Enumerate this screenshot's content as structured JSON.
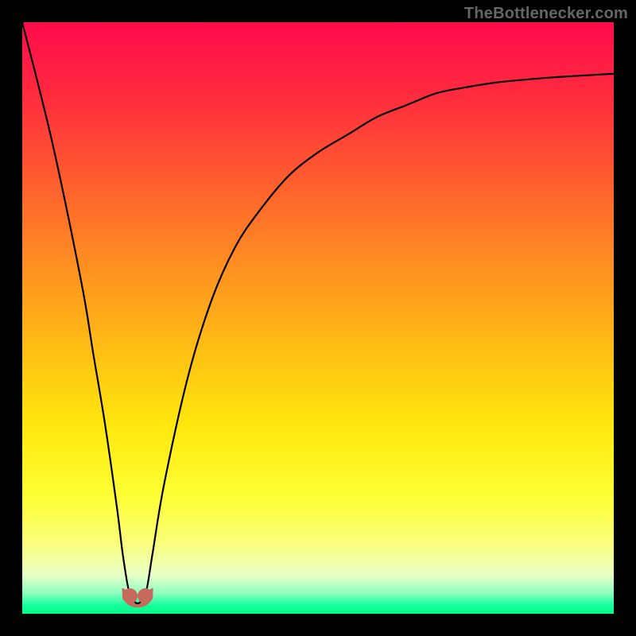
{
  "watermark": "TheBottlenecker.com",
  "gradient": {
    "stops": [
      {
        "offset": 0.0,
        "color": "#ff0b4b"
      },
      {
        "offset": 0.12,
        "color": "#ff2a3e"
      },
      {
        "offset": 0.25,
        "color": "#ff5730"
      },
      {
        "offset": 0.4,
        "color": "#ff8b22"
      },
      {
        "offset": 0.55,
        "color": "#ffbd14"
      },
      {
        "offset": 0.68,
        "color": "#ffe70d"
      },
      {
        "offset": 0.8,
        "color": "#feff33"
      },
      {
        "offset": 0.88,
        "color": "#faff7a"
      },
      {
        "offset": 0.935,
        "color": "#e8ffc8"
      },
      {
        "offset": 0.965,
        "color": "#8effc0"
      },
      {
        "offset": 0.985,
        "color": "#17ff9c"
      },
      {
        "offset": 1.0,
        "color": "#00ff88"
      }
    ]
  },
  "chart_data": {
    "type": "line",
    "title": "",
    "xlabel": "",
    "ylabel": "",
    "xlim": [
      0,
      100
    ],
    "ylim": [
      0,
      100
    ],
    "series": [
      {
        "name": "bottleneck-curve",
        "x": [
          0,
          5,
          10,
          12,
          14,
          16,
          17,
          18,
          19,
          20,
          21,
          22,
          24,
          28,
          32,
          36,
          40,
          45,
          50,
          55,
          60,
          65,
          70,
          75,
          80,
          85,
          90,
          95,
          100
        ],
        "values": [
          100,
          80,
          56,
          44,
          32,
          18,
          10,
          4,
          2,
          2,
          4,
          10,
          22,
          40,
          53,
          62,
          68,
          74,
          78,
          81,
          84,
          86,
          88,
          89,
          89.8,
          90.3,
          90.7,
          91,
          91.3
        ]
      }
    ],
    "markers": [
      {
        "name": "valley-left-marker",
        "x": 18.2,
        "y": 3.0,
        "color": "#c76a5e",
        "r": 1.3
      },
      {
        "name": "valley-right-marker",
        "x": 20.8,
        "y": 3.0,
        "color": "#c76a5e",
        "r": 1.3
      }
    ],
    "valley_band": {
      "x0": 17.0,
      "x1": 22.0,
      "y0": 1.2,
      "y1": 4.2,
      "color": "#c76a5e"
    }
  }
}
